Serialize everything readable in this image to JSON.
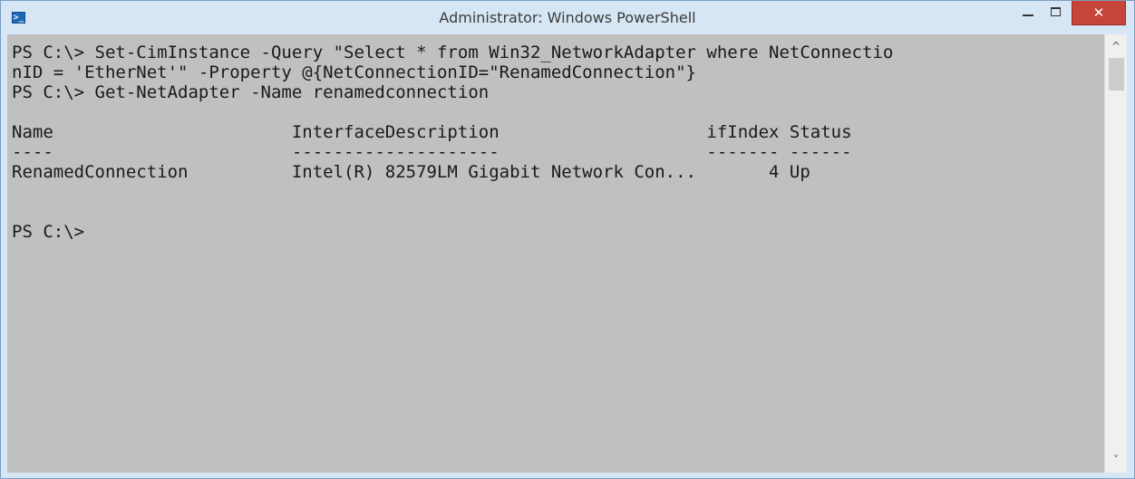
{
  "window": {
    "title": "Administrator: Windows PowerShell",
    "app_icon_glyph": ">_",
    "close_glyph": "✕"
  },
  "colors": {
    "console_background": "#c0c0c0",
    "console_text": "#1a1a1a",
    "close_button": "#c7443b",
    "titlebar": "#d7e6f4"
  },
  "console": {
    "lines": [
      "PS C:\\> Set-CimInstance -Query \"Select * from Win32_NetworkAdapter where NetConnectio",
      "nID = 'EtherNet'\" -Property @{NetConnectionID=\"RenamedConnection\"}",
      "PS C:\\> Get-NetAdapter -Name renamedconnection",
      "Name                       InterfaceDescription                    ifIndex Status",
      "----                       --------------------                    ------- ------",
      "RenamedConnection          Intel(R) 82579LM Gigabit Network Con...       4 Up",
      "PS C:\\>"
    ]
  },
  "scrollbar": {
    "up_glyph": "^",
    "down_glyph": "˅"
  }
}
